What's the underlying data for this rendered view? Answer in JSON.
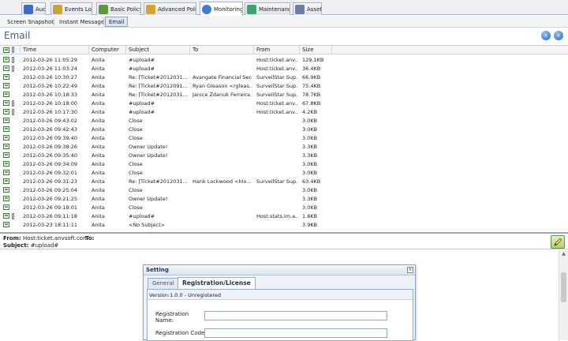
{
  "tabs": [
    {
      "label": "Audit",
      "icon": "audit-icon",
      "color": "#3a6fc9"
    },
    {
      "label": "Events Log",
      "icon": "events-log-icon",
      "color": "#c8a23a"
    },
    {
      "label": "Basic Policy",
      "icon": "basic-policy-icon",
      "color": "#5b9a3e"
    },
    {
      "label": "Advanced Polic",
      "icon": "advanced-policy-icon",
      "color": "#d5a531"
    },
    {
      "label": "Monitoring",
      "icon": "monitoring-icon",
      "color": "#3d7fd0"
    },
    {
      "label": "Maintenance",
      "icon": "maintenance-icon",
      "color": "#3aa56b"
    },
    {
      "label": "Asset",
      "icon": "asset-icon",
      "color": "#6c7ea5"
    }
  ],
  "subtabs": [
    "Screen Snapshot",
    "Instant Message",
    "Email"
  ],
  "page_title": "Email",
  "columns": [
    "Time",
    "Computer",
    "Subject",
    "To",
    "From",
    "Size"
  ],
  "rows": [
    {
      "time": "2012-03-26 11:05:29",
      "computer": "Anita",
      "subject": "#upload#",
      "to": "",
      "from": "Host:ticket.anv...",
      "size": "129.1KB",
      "attach": true
    },
    {
      "time": "2012-03-26 11:03:24",
      "computer": "Anita",
      "subject": "#upload#",
      "to": "",
      "from": "Host:ticket.anv...",
      "size": "36.4KB",
      "attach": true
    },
    {
      "time": "2012-03-26 10:30:27",
      "computer": "Anita",
      "subject": "Re: [Ticket#2012031...",
      "to": "Avangate Financial Ser...",
      "from": "SurveilStar Sup...",
      "size": "66.9KB",
      "attach": false
    },
    {
      "time": "2012-03-26 10:22:49",
      "computer": "Anita",
      "subject": "Re: [Ticket#2012091...",
      "to": "Ryan Gleason <rgleas...",
      "from": "SurveilStar Sup...",
      "size": "75.4KB",
      "attach": false
    },
    {
      "time": "2012-03-26 10:18:33",
      "computer": "Anita",
      "subject": "Re: [Ticket#2012031...",
      "to": "Janice Zdanuk Ferreira...",
      "from": "SurveilStar Sup...",
      "size": "78.7KB",
      "attach": false
    },
    {
      "time": "2012-03-26 10:18:00",
      "computer": "Anita",
      "subject": "#upload#",
      "to": "",
      "from": "Host:ticket.anv...",
      "size": "67.8KB",
      "attach": true
    },
    {
      "time": "2012-03-26 10:17:30",
      "computer": "Anita",
      "subject": "#upload#",
      "to": "",
      "from": "Host:ticket.anv...",
      "size": "4.2KB",
      "attach": true
    },
    {
      "time": "2012-03-26 09:43:02",
      "computer": "Anita",
      "subject": "Close",
      "to": "",
      "from": "",
      "size": "3.0KB",
      "attach": false
    },
    {
      "time": "2012-03-26 09:42:43",
      "computer": "Anita",
      "subject": "Close",
      "to": "",
      "from": "",
      "size": "3.0KB",
      "attach": false
    },
    {
      "time": "2012-03-26 09:39:40",
      "computer": "Anita",
      "subject": "Close",
      "to": "",
      "from": "",
      "size": "3.0KB",
      "attach": false
    },
    {
      "time": "2012-03-26 09:38:26",
      "computer": "Anita",
      "subject": "Owner Update!",
      "to": "",
      "from": "",
      "size": "3.3KB",
      "attach": false
    },
    {
      "time": "2012-03-26 09:35:40",
      "computer": "Anita",
      "subject": "Owner Update!",
      "to": "",
      "from": "",
      "size": "3.3KB",
      "attach": false
    },
    {
      "time": "2012-03-26 09:34:09",
      "computer": "Anita",
      "subject": "Close",
      "to": "",
      "from": "",
      "size": "3.0KB",
      "attach": false
    },
    {
      "time": "2012-03-26 09:32:01",
      "computer": "Anita",
      "subject": "Close",
      "to": "",
      "from": "",
      "size": "3.0KB",
      "attach": false
    },
    {
      "time": "2012-03-26 09:31:23",
      "computer": "Anita",
      "subject": "Re: [Ticket#2012031...",
      "to": "Hank Lockwood <hlo...",
      "from": "SurveilStar Sup...",
      "size": "63.4KB",
      "attach": false
    },
    {
      "time": "2012-03-26 09:25:04",
      "computer": "Anita",
      "subject": "Close",
      "to": "",
      "from": "",
      "size": "3.0KB",
      "attach": false
    },
    {
      "time": "2012-03-26 09:21:25",
      "computer": "Anita",
      "subject": "Owner Update!",
      "to": "",
      "from": "",
      "size": "3.3KB",
      "attach": false
    },
    {
      "time": "2012-03-26 09:18:01",
      "computer": "Anita",
      "subject": "Close",
      "to": "",
      "from": "",
      "size": "3.0KB",
      "attach": false
    },
    {
      "time": "2012-03-26 09:11:18",
      "computer": "Anita",
      "subject": "#upload#",
      "to": "",
      "from": "Host:stats.im.a...",
      "size": "1.8KB",
      "attach": true
    },
    {
      "time": "2012-03-23 18:11:11",
      "computer": "Anita",
      "subject": "<No Subject>",
      "to": "",
      "from": "",
      "size": "3.9KB",
      "attach": false
    }
  ],
  "preview": {
    "from_label": "From:",
    "from_value": "Host:ticket.anvsoft.com",
    "to_label": "To:",
    "to_value": "",
    "subject_label": "Subject:",
    "subject_value": "#upload#"
  },
  "dialog": {
    "title": "Setting",
    "close": "×",
    "tabs": [
      "General",
      "Registration/License"
    ],
    "version": "Version:1.0.0 - Unregistered",
    "fields": [
      {
        "label": "Registration Name:",
        "value": ""
      },
      {
        "label": "Registration Code:",
        "value": ""
      }
    ]
  },
  "colors": {
    "accent": "#2468c6",
    "title": "#4a5b78",
    "selected_subtab": "#dbe7f7"
  }
}
